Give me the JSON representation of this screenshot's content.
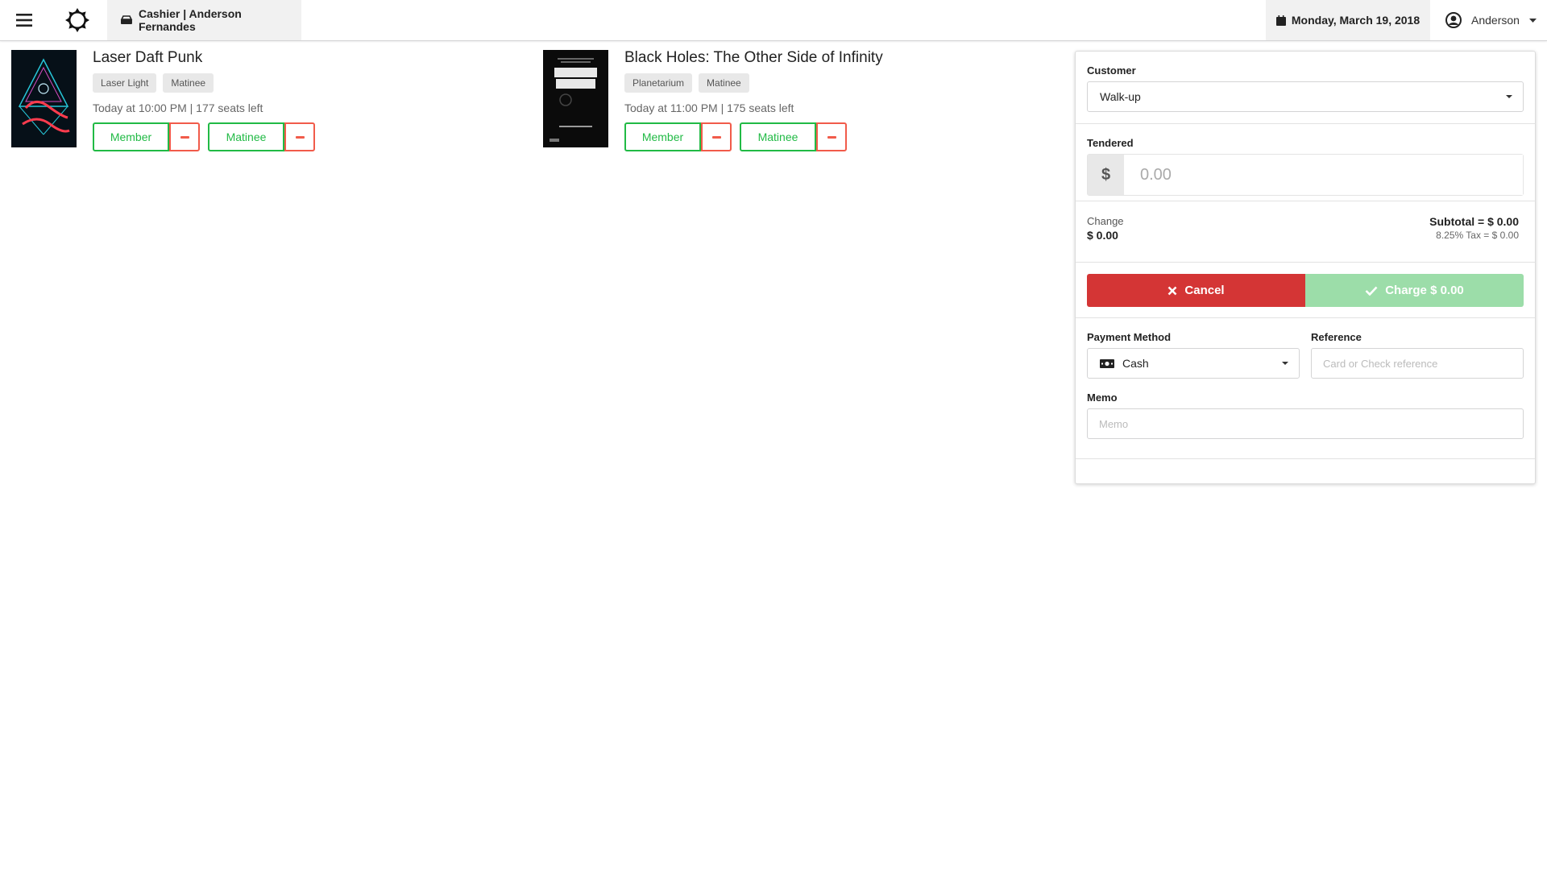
{
  "header": {
    "cashier_label": "Cashier | Anderson Fernandes",
    "date": "Monday, March 19, 2018",
    "user": "Anderson"
  },
  "events": [
    {
      "title": "Laser Daft Punk",
      "tags": [
        "Laser Light",
        "Matinee"
      ],
      "meta": "Today at 10:00 PM | 177 seats left",
      "buttons": [
        "Member",
        "Matinee"
      ]
    },
    {
      "title": "Black Holes: The Other Side of Infinity",
      "tags": [
        "Planetarium",
        "Matinee"
      ],
      "meta": "Today at 11:00 PM | 175 seats left",
      "buttons": [
        "Member",
        "Matinee"
      ]
    }
  ],
  "panel": {
    "customer_label": "Customer",
    "customer_value": "Walk-up",
    "tendered_label": "Tendered",
    "currency_symbol": "$",
    "tendered_placeholder": "0.00",
    "change_label": "Change",
    "change_value": "$ 0.00",
    "subtotal": "Subtotal = $ 0.00",
    "tax": "8.25% Tax = $ 0.00",
    "cancel_label": "Cancel",
    "charge_label": "Charge $ 0.00",
    "payment_method_label": "Payment Method",
    "payment_method_value": "Cash",
    "reference_label": "Reference",
    "reference_placeholder": "Card or Check reference",
    "memo_label": "Memo",
    "memo_placeholder": "Memo"
  },
  "colors": {
    "green": "#21ba45",
    "red": "#d43535",
    "minus_red": "#f15b4a",
    "charge_disabled": "#9cdda9"
  }
}
